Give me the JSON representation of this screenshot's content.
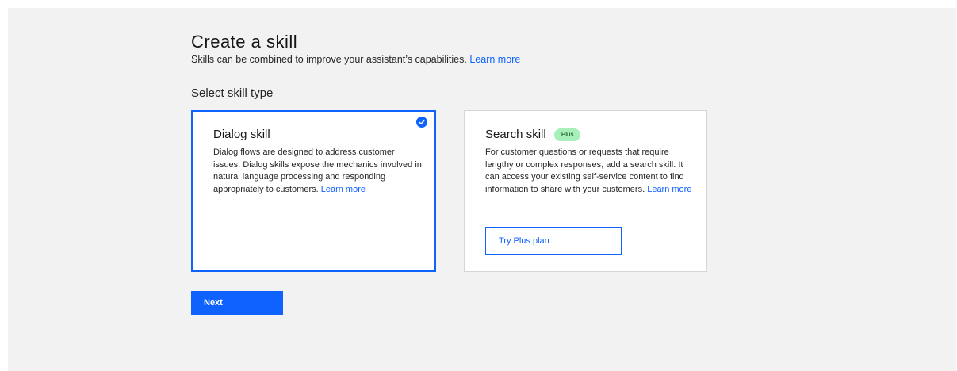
{
  "header": {
    "title": "Create a skill",
    "subtitle": "Skills can be combined to improve your assistant’s capabilities.",
    "learn_more": "Learn more"
  },
  "section_label": "Select skill type",
  "cards": {
    "dialog": {
      "title": "Dialog skill",
      "description": "Dialog flows are designed to address customer issues. Dialog skills expose the mechanics involved in natural language processing and responding appropriately to customers.",
      "learn_more": "Learn more",
      "selected": true,
      "check_icon": "checkmark-filled-icon"
    },
    "search": {
      "title": "Search skill",
      "badge": "Plus",
      "description": "For customer questions or requests that require lengthy or complex responses, add a search skill. It can access your existing self-service content to find information to share with your customers.",
      "learn_more": "Learn more",
      "button_label": "Try Plus plan"
    }
  },
  "next_button_label": "Next",
  "colors": {
    "accent": "#0f62fe",
    "badge_bg": "#a7f0ba",
    "panel_bg": "#f2f2f2"
  }
}
